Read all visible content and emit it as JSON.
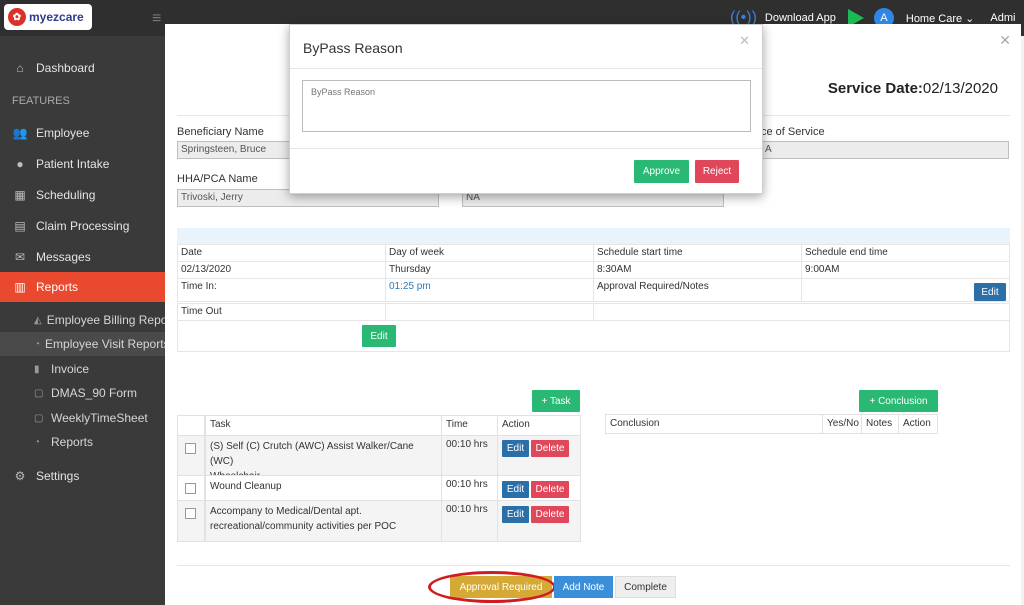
{
  "brand": {
    "name": "myezcare"
  },
  "topbar": {
    "download_label": "Download App",
    "org_label": "Home Care ⌄",
    "user_label": "Admi"
  },
  "sidebar": {
    "heading": "FEATURES",
    "items": {
      "dashboard": "Dashboard",
      "employee": "Employee",
      "patient_intake": "Patient Intake",
      "scheduling": "Scheduling",
      "claim_processing": "Claim Processing",
      "messages": "Messages",
      "reports": "Reports",
      "settings": "Settings"
    },
    "reports_sub": [
      "Employee Billing Report",
      "Employee Visit Reports",
      "Invoice",
      "DMAS_90 Form",
      "WeeklyTimeSheet",
      "Reports"
    ]
  },
  "visit": {
    "service_date_label": "Service Date:",
    "service_date": "02/13/2020",
    "beneficiary_label": "Beneficiary Name",
    "beneficiary_value": "Springsteen, Bruce",
    "place_label": "ce of Service",
    "place_value": "A",
    "hha_label": "HHA/PCA Name",
    "hha_value": "Trivoski, Jerry",
    "na_value": "NA"
  },
  "schedule": {
    "headers": [
      "Date",
      "Day of week",
      "Schedule start time",
      "Schedule end time"
    ],
    "values": [
      "02/13/2020",
      "Thursday",
      "8:30AM",
      "9:00AM"
    ],
    "time_in_label": "Time In:",
    "time_in_value": "01:25 pm",
    "approval_label": "Approval Required/Notes",
    "time_out_label": "Time Out",
    "edit_label": "Edit"
  },
  "tasks": {
    "add_label": "+ Task",
    "headers": {
      "task": "Task",
      "time": "Time",
      "action": "Action"
    },
    "rows": [
      {
        "task_l1": "(S) Self (C) Crutch (AWC) Assist Walker/Cane (WC)",
        "task_l2": "Wheelchair",
        "time": "00:10 hrs"
      },
      {
        "task_l1": "Wound Cleanup",
        "task_l2": "",
        "time": "00:10 hrs"
      },
      {
        "task_l1": "Accompany to Medical/Dental apt.",
        "task_l2": "recreational/community activities per POC",
        "time": "00:10 hrs"
      }
    ],
    "edit_label": "Edit",
    "delete_label": "Delete"
  },
  "conclusion": {
    "add_label": "+ Conclusion",
    "headers": {
      "conclusion": "Conclusion",
      "yesno": "Yes/No",
      "notes": "Notes",
      "action": "Action"
    }
  },
  "bypass": {
    "title": "ByPass Reason",
    "placeholder": "ByPass Reason",
    "approve_label": "Approve",
    "reject_label": "Reject"
  },
  "footer": {
    "approval_label": "Approval Required",
    "addnote_label": "Add Note",
    "complete_label": "Complete"
  },
  "colors": {
    "sidebar_active": "#e94a2f",
    "green": "#29b974",
    "blue": "#2b6fa8",
    "red": "#e0475a",
    "gold": "#d4a935"
  }
}
